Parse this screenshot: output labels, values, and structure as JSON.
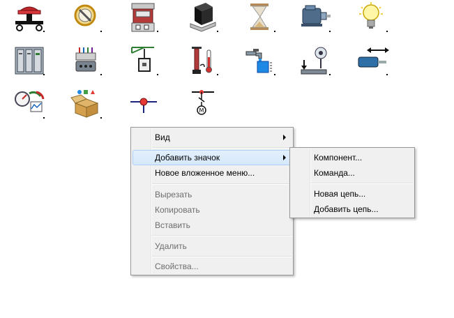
{
  "icons": [
    {
      "name": "emergency-stop-button-icon"
    },
    {
      "name": "prohibited-sign-icon"
    },
    {
      "name": "relay-module-icon"
    },
    {
      "name": "black-box-device-icon"
    },
    {
      "name": "hourglass-icon"
    },
    {
      "name": "electric-motor-icon"
    },
    {
      "name": "light-bulb-icon"
    },
    {
      "name": "control-cabinet-icon"
    },
    {
      "name": "terminal-connector-icon"
    },
    {
      "name": "valve-actuator-icon"
    },
    {
      "name": "pump-thermometer-icon"
    },
    {
      "name": "water-tap-icon"
    },
    {
      "name": "level-sensor-icon"
    },
    {
      "name": "linear-cylinder-icon"
    },
    {
      "name": "gauges-panel-icon"
    },
    {
      "name": "open-box-components-icon"
    },
    {
      "name": "pipe-junction-icon"
    },
    {
      "name": "motor-circuit-icon"
    }
  ],
  "context_menu": {
    "view": "Вид",
    "add_icon": "Добавить значок",
    "new_submenu": "Новое вложенное меню...",
    "cut": "Вырезать",
    "copy": "Копировать",
    "paste": "Вставить",
    "delete": "Удалить",
    "properties": "Свойства..."
  },
  "submenu": {
    "component": "Компонент...",
    "command": "Команда...",
    "new_chain": "Новая цепь...",
    "add_chain": "Добавить цепь..."
  }
}
